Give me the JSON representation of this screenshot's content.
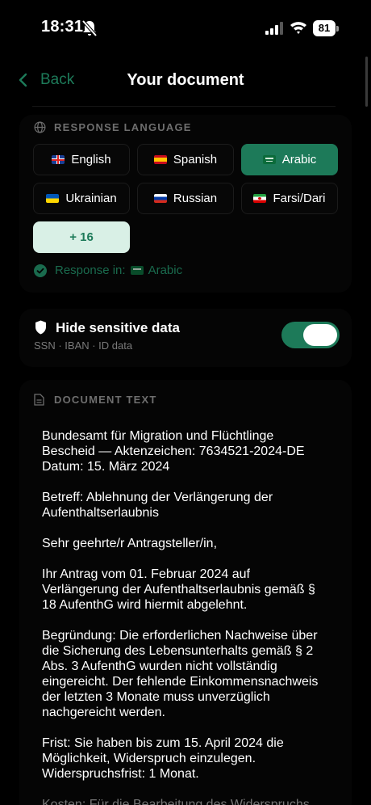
{
  "status_bar": {
    "time": "18:31",
    "battery": "81",
    "icons": [
      "bell-slash-icon",
      "cellular-signal-icon",
      "wifi-icon",
      "battery-icon"
    ]
  },
  "nav": {
    "back_label": "Back",
    "title": "Your document"
  },
  "response_language": {
    "heading": "RESPONSE LANGUAGE",
    "languages": [
      {
        "label": "English",
        "flag": "uk-flag-icon",
        "active": false
      },
      {
        "label": "Spanish",
        "flag": "spain-flag-icon",
        "active": false
      },
      {
        "label": "Arabic",
        "flag": "saudi-flag-icon",
        "active": true
      },
      {
        "label": "Ukrainian",
        "flag": "ukraine-flag-icon",
        "active": false
      },
      {
        "label": "Russian",
        "flag": "russia-flag-icon",
        "active": false
      },
      {
        "label": "Farsi/Dari",
        "flag": "iran-flag-icon",
        "active": false
      }
    ],
    "more_label": "+ 16",
    "response_prefix": "Response in:",
    "response_value": "Arabic"
  },
  "sensitive": {
    "title": "Hide sensitive data",
    "subtitle": "SSN · IBAN · ID data",
    "enabled": true
  },
  "document": {
    "heading": "DOCUMENT TEXT",
    "paragraphs": [
      "Bundesamt für Migration und Flüchtlinge\nBescheid — Aktenzeichen: 7634521-2024-DE\nDatum: 15. März 2024",
      "Betreff: Ablehnung der Verlängerung der\nAufenthaltserlaubnis",
      "Sehr geehrte/r Antragsteller/in,",
      "Ihr Antrag vom 01. Februar 2024 auf\nVerlängerung der Aufenthaltserlaubnis gemäß §\n18 AufenthG wird hiermit abgelehnt.",
      "Begründung: Die erforderlichen Nachweise über\ndie Sicherung des Lebensunterhalts gemäß § 2\nAbs. 3 AufenthG wurden nicht vollständig\neingereicht. Der fehlende Einkommensnachweis\nder letzten 3 Monate muss unverzüglich\nnachgereicht werden.",
      "Frist: Sie haben bis zum 15. April 2024 die\nMöglichkeit, Widerspruch einzulegen.\nWiderspruchsfrist: 1 Monat.",
      "Kosten: Für die Bearbeitung des Widerspruchs"
    ]
  },
  "colors": {
    "accent": "#1d7a59",
    "accent_light": "#d9f0e6",
    "background": "#000000"
  }
}
